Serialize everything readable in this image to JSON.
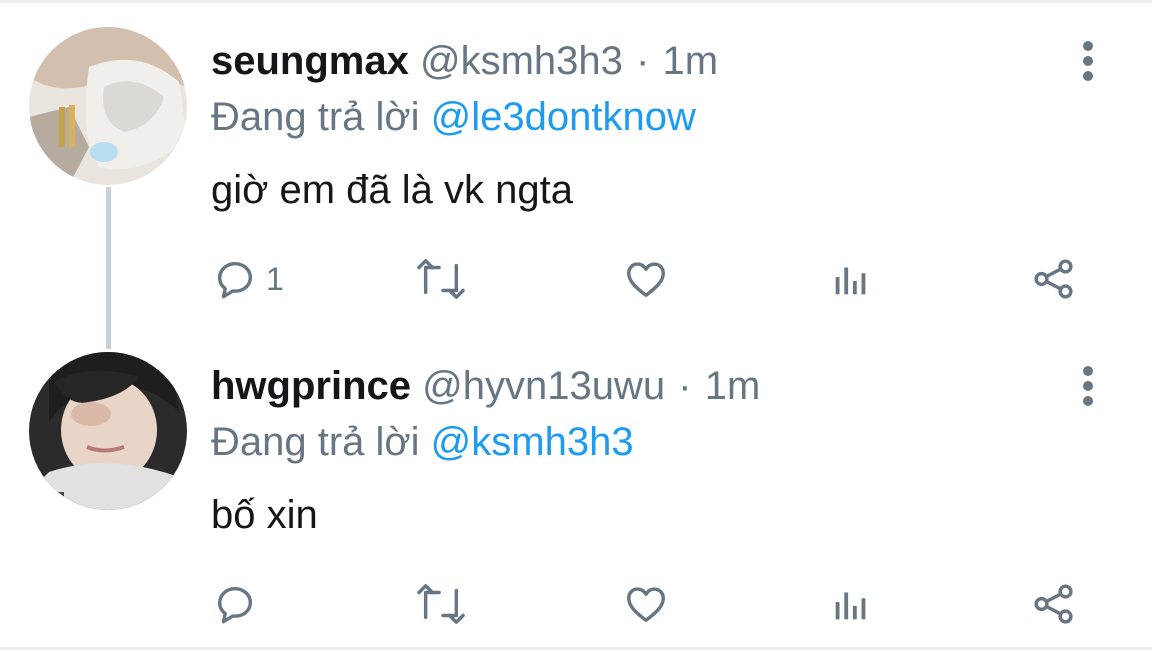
{
  "tweets": [
    {
      "name": "seungmax",
      "handle": "@ksmh3h3",
      "separator": "·",
      "time": "1m",
      "replying_prefix": "Đang trả lời",
      "replying_to": "@le3dontknow",
      "text": "giờ em đã là vk ngta",
      "reply_count": "1",
      "avatar_colors": [
        "#d6c3b4",
        "#ece7e1",
        "#9a8a7c"
      ]
    },
    {
      "name": "hwgprince",
      "handle": "@hyvn13uwu",
      "separator": "·",
      "time": "1m",
      "replying_prefix": "Đang trả lời",
      "replying_to": "@ksmh3h3",
      "text": "bố xin",
      "reply_count": "",
      "avatar_colors": [
        "#3a3a3a",
        "#e7d2c6",
        "#d9d9d9"
      ]
    }
  ],
  "icons": {
    "reply": "reply-icon",
    "retweet": "retweet-icon",
    "like": "heart-icon",
    "stats": "analytics-icon",
    "share": "share-icon",
    "more": "more-options-icon"
  },
  "colors": {
    "text_primary": "#141619",
    "text_secondary": "#687684",
    "link": "#1d9bf0",
    "thread_line": "#c9d1d8",
    "divider": "#ebeef0"
  }
}
